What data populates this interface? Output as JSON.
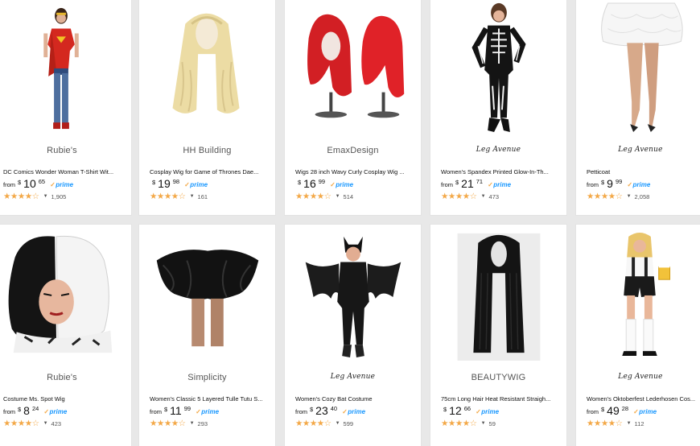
{
  "products": [
    {
      "brand": "Rubie's",
      "brand_style": "plain",
      "title": "DC Comics Wonder Woman T-Shirt Wit...",
      "from": "from",
      "currency": "$",
      "whole": "10",
      "fraction": "65",
      "prime": "prime",
      "stars": "★★★★☆",
      "count": "1,905",
      "image": "wonder-woman-costume-image"
    },
    {
      "brand": "HH Building",
      "brand_style": "plain",
      "title": "Cosplay Wig for Game of Thrones Dae...",
      "from": "",
      "currency": "$",
      "whole": "19",
      "fraction": "98",
      "prime": "prime",
      "stars": "★★★★☆",
      "count": "161",
      "image": "blonde-wig-image"
    },
    {
      "brand": "EmaxDesign",
      "brand_style": "plain",
      "title": "Wigs 28 inch Wavy Curly Cosplay Wig ...",
      "from": "",
      "currency": "$",
      "whole": "16",
      "fraction": "99",
      "prime": "prime",
      "stars": "★★★★☆",
      "count": "514",
      "image": "red-wig-image"
    },
    {
      "brand": "Leg Avenue",
      "brand_style": "script",
      "title": "Women's Spandex Printed Glow-In-Th...",
      "from": "from",
      "currency": "$",
      "whole": "21",
      "fraction": "71",
      "prime": "prime",
      "stars": "★★★★☆",
      "count": "473",
      "image": "skeleton-costume-image"
    },
    {
      "brand": "Leg Avenue",
      "brand_style": "script",
      "title": "Petticoat",
      "from": "from",
      "currency": "$",
      "whole": "9",
      "fraction": "99",
      "prime": "prime",
      "stars": "★★★★☆",
      "count": "2,058",
      "image": "petticoat-image"
    },
    {
      "brand": "Rubie's",
      "brand_style": "plain",
      "title": "Costume Ms. Spot Wig",
      "from": "from",
      "currency": "$",
      "whole": "8",
      "fraction": "24",
      "prime": "prime",
      "stars": "★★★★☆",
      "count": "423",
      "image": "black-white-wig-image"
    },
    {
      "brand": "Simplicity",
      "brand_style": "plain",
      "title": "Women's Classic 5 Layered Tulle Tutu S...",
      "from": "from",
      "currency": "$",
      "whole": "11",
      "fraction": "99",
      "prime": "prime",
      "stars": "★★★★☆",
      "count": "293",
      "image": "tutu-image"
    },
    {
      "brand": "Leg Avenue",
      "brand_style": "script",
      "title": "Women's Cozy Bat Costume",
      "from": "from",
      "currency": "$",
      "whole": "23",
      "fraction": "40",
      "prime": "prime",
      "stars": "★★★★☆",
      "count": "599",
      "image": "bat-costume-image"
    },
    {
      "brand": "BEAUTYWIG",
      "brand_style": "plain",
      "title": "75cm Long Hair Heat Resistant Straigh...",
      "from": "",
      "currency": "$",
      "whole": "12",
      "fraction": "66",
      "prime": "prime",
      "stars": "★★★★☆",
      "count": "59",
      "image": "black-long-wig-image"
    },
    {
      "brand": "Leg Avenue",
      "brand_style": "script",
      "title": "Women's Oktoberfest Lederhosen Cos...",
      "from": "from",
      "currency": "$",
      "whole": "49",
      "fraction": "28",
      "prime": "prime",
      "stars": "★★★★☆",
      "count": "112",
      "image": "oktoberfest-costume-image"
    }
  ]
}
